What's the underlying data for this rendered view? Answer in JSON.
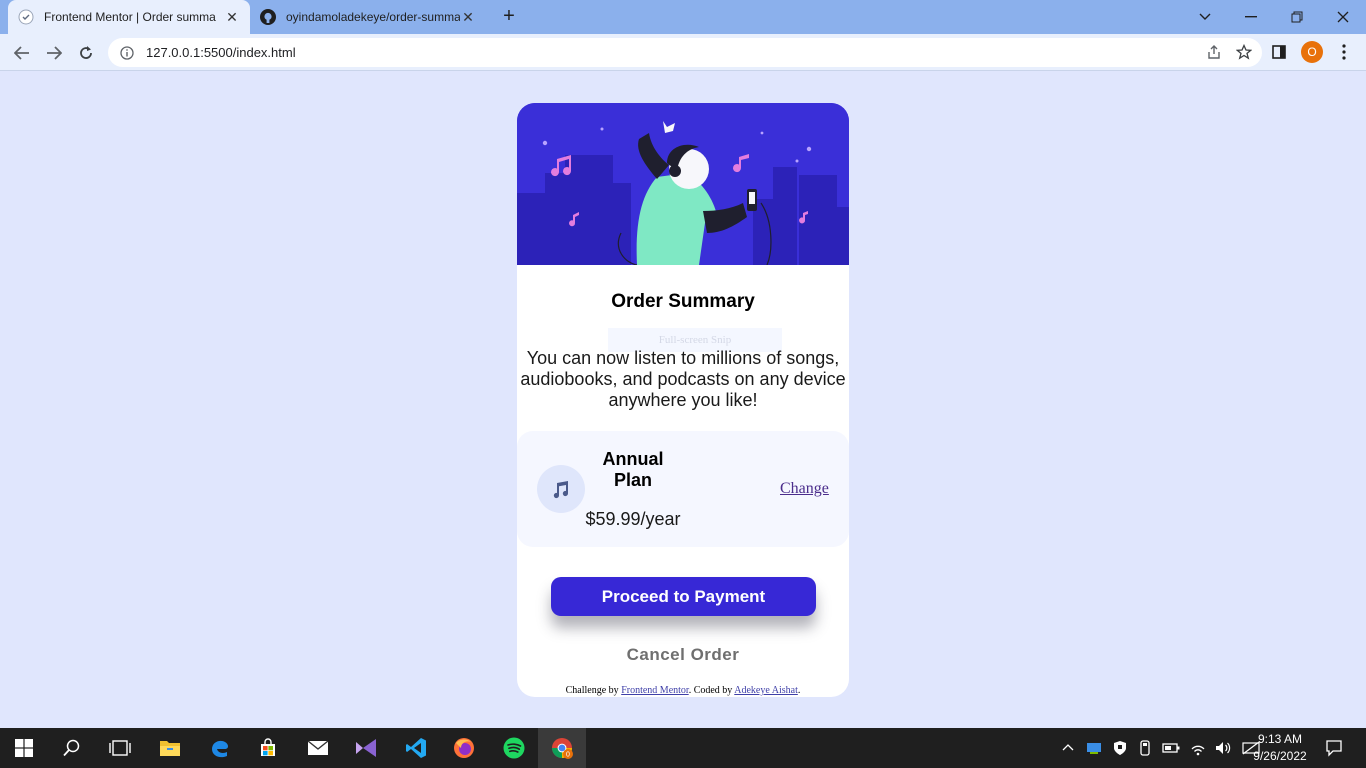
{
  "browser": {
    "tabs": [
      {
        "title": "Frontend Mentor | Order summa",
        "active": true
      },
      {
        "title": "oyindamoladekeye/order-summa",
        "active": false
      }
    ],
    "url": "127.0.0.1:5500/index.html",
    "profile_initial": "O"
  },
  "card": {
    "title": "Order Summary",
    "ghost_label": "Full-screen Snip",
    "description": "You can now listen to millions of songs, audiobooks, and podcasts on any device anywhere you like!",
    "plan": {
      "name": "Annual Plan",
      "price": "$59.99/year",
      "change_label": "Change"
    },
    "pay_label": "Proceed to Payment",
    "cancel_label": "Cancel Order",
    "attribution": {
      "prefix": "Challenge by ",
      "link1": "Frontend Mentor",
      "middle": ". Coded by ",
      "link2": "Adekeye Aishat",
      "suffix": "."
    }
  },
  "taskbar": {
    "time": "9:13 AM",
    "date": "9/26/2022",
    "chrome_badge": "0"
  },
  "colors": {
    "page_bg": "#e0e6fd",
    "hero_bg": "#3a2fd8",
    "accent": "#3728d6",
    "plan_bg": "#f5f7ff"
  }
}
